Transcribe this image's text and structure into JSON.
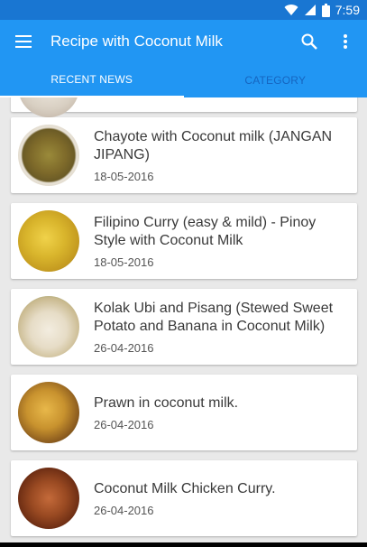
{
  "status": {
    "time": "7:59",
    "icons": [
      "wifi-icon",
      "signal-icon",
      "battery-icon"
    ]
  },
  "appbar": {
    "title": "Recipe with Coconut Milk",
    "icons": [
      "menu-icon",
      "search-icon",
      "overflow-menu-icon"
    ]
  },
  "tabs": [
    {
      "label": "RECENT NEWS",
      "active": true
    },
    {
      "label": "CATEGORY",
      "active": false
    }
  ],
  "recipes": [
    {
      "title": "Chayote with Coconut milk (JANGAN JIPANG)",
      "date": "18-05-2016"
    },
    {
      "title": "Filipino Curry (easy & mild) - Pinoy Style with Coconut Milk",
      "date": "18-05-2016"
    },
    {
      "title": "Kolak Ubi and Pisang (Stewed Sweet Potato and Banana in Coconut Milk)",
      "date": "26-04-2016"
    },
    {
      "title": "Prawn in coconut milk.",
      "date": "26-04-2016"
    },
    {
      "title": "Coconut Milk Chicken Curry.",
      "date": "26-04-2016"
    }
  ],
  "colors": {
    "primary": "#2196f3",
    "primary_dark": "#1976d2",
    "tab_inactive": "#1565c0",
    "background": "#e9e9e9"
  }
}
